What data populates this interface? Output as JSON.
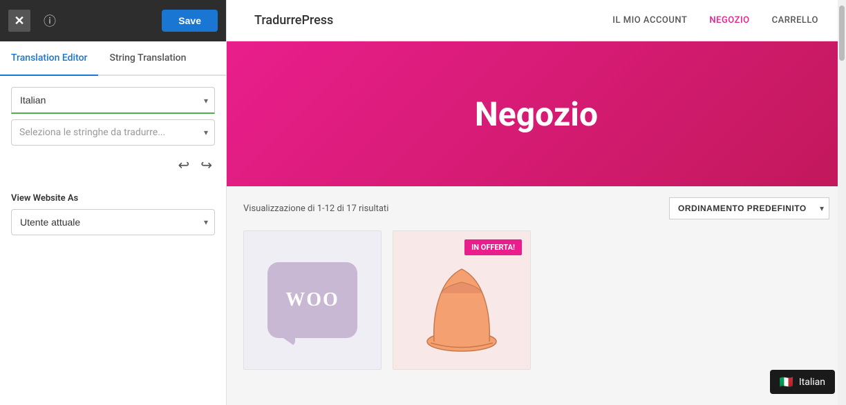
{
  "topbar": {
    "close_label": "✕",
    "info_label": "ⓘ",
    "save_label": "Save"
  },
  "tabs": [
    {
      "id": "translation-editor",
      "label": "Translation Editor",
      "active": true
    },
    {
      "id": "string-translation",
      "label": "String Translation",
      "active": false
    }
  ],
  "language_select": {
    "value": "Italian",
    "placeholder": "Italian"
  },
  "strings_select": {
    "placeholder": "Seleziona le stringhe da tradurre..."
  },
  "undo_redo": {
    "undo_icon": "↩",
    "redo_icon": "↪"
  },
  "view_website_as": {
    "label": "View Website As",
    "value": "Utente attuale"
  },
  "site": {
    "logo": "TradurrePress",
    "nav": [
      {
        "label": "IL MIO ACCOUNT",
        "active": false
      },
      {
        "label": "NEGOZIO",
        "active": true
      },
      {
        "label": "CARRELLO",
        "active": false
      }
    ]
  },
  "hero": {
    "title": "Negozio"
  },
  "products": {
    "results_text": "Visualizzazione di 1-12 di 17 risultati",
    "sort_label": "ORDINAMENTO PREDEFINITO",
    "badge_offerta": "IN OFFERTA!",
    "woo_text": "WOO"
  },
  "language_indicator": {
    "flag": "🇮🇹",
    "label": "Italian"
  }
}
